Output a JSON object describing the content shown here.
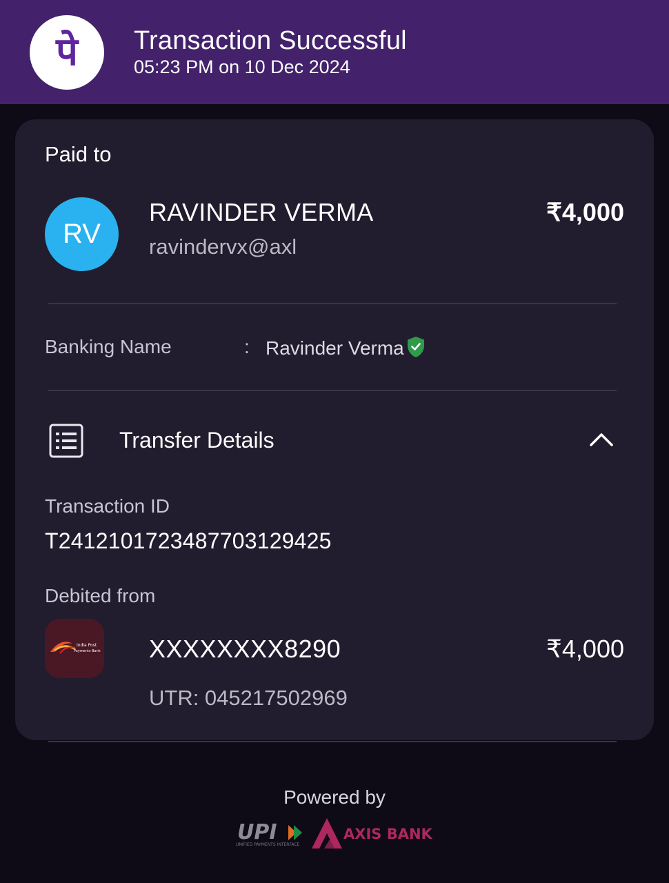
{
  "header": {
    "title": "Transaction Successful",
    "subtitle": "05:23 PM on 10 Dec 2024",
    "logo_glyph": "पे",
    "brand_color": "#43226b",
    "logo_color": "#5f259f"
  },
  "payee": {
    "section_label": "Paid to",
    "initials": "RV",
    "name": "RAVINDER VERMA",
    "upi_id": "ravindervx@axl",
    "amount": "₹4,000",
    "avatar_color": "#29b2ef"
  },
  "banking": {
    "label": "Banking Name",
    "separator": ":",
    "value": "Ravinder Verma",
    "verified_icon": "verified-shield-icon"
  },
  "transfer": {
    "section_label": "Transfer Details",
    "section_icon": "receipt-list-icon",
    "toggle_icon": "chevron-up-icon",
    "txn_label": "Transaction ID",
    "txn_id": "T2412101723487703129425",
    "debited_label": "Debited from",
    "bank_logo_name": "india-post-payments-bank-logo",
    "bank_logo_text_1": "India Post",
    "bank_logo_text_2": "Payments Bank",
    "account": "XXXXXXXX8290",
    "account_amount": "₹4,000",
    "utr": "UTR: 045217502969"
  },
  "footer": {
    "powered_by": "Powered by",
    "upi_text": "UPI",
    "upi_subtext": "UNIFIED PAYMENTS INTERFACE",
    "axis_text": "AXIS BANK",
    "axis_color": "#ae275f"
  }
}
